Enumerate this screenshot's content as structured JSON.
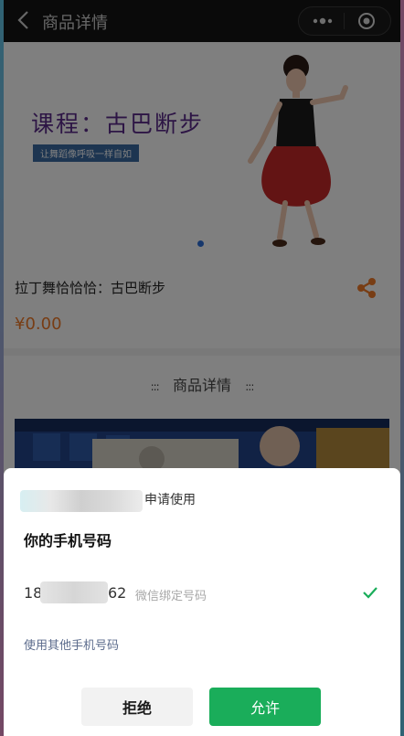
{
  "navbar": {
    "title": "商品详情",
    "back_icon": "chevron-left-icon",
    "more_icon": "more-dots-icon",
    "close_icon": "close-target-icon"
  },
  "banner": {
    "title": "课程：古巴断步",
    "tagline": "让舞蹈像呼吸一样自如",
    "carousel_indicator_color": "#2d6fd8"
  },
  "product": {
    "name": "拉丁舞恰恰恰：古巴断步",
    "price": "¥0.00",
    "share_icon": "share-icon",
    "price_color": "#f07a28"
  },
  "detail": {
    "section_title": "商品详情",
    "mark_left": ":::",
    "mark_right": ":::"
  },
  "auth_sheet": {
    "apply_text": "申请使用",
    "title": "你的手机号码",
    "phone_prefix": "18",
    "phone_suffix": "62",
    "phone_note": "微信绑定号码",
    "other_phone_link": "使用其他手机号码",
    "reject_label": "拒绝",
    "allow_label": "允许",
    "selected_check_icon": "check-icon",
    "accent_color": "#1aad5a"
  }
}
